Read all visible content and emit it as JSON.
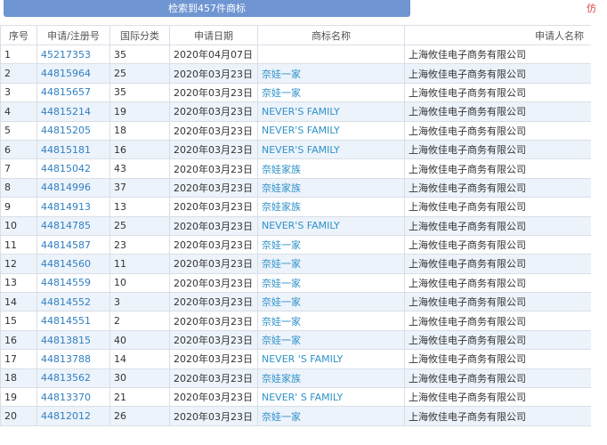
{
  "banner": {
    "text": "检索到457件商标"
  },
  "corner": {
    "text": "仿"
  },
  "table": {
    "headers": {
      "no": "序号",
      "regno": "申请/注册号",
      "cls": "国际分类",
      "date": "申请日期",
      "mark": "商标名称",
      "applicant": "申请人名称"
    },
    "rows": [
      {
        "no": "1",
        "regno": "45217353",
        "cls": "35",
        "date": "2020年04月07日",
        "mark": "",
        "applicant": "上海攸佳电子商务有限公司"
      },
      {
        "no": "2",
        "regno": "44815964",
        "cls": "25",
        "date": "2020年03月23日",
        "mark": "奈娃一家",
        "applicant": "上海攸佳电子商务有限公司"
      },
      {
        "no": "3",
        "regno": "44815657",
        "cls": "35",
        "date": "2020年03月23日",
        "mark": "奈娃一家",
        "applicant": "上海攸佳电子商务有限公司"
      },
      {
        "no": "4",
        "regno": "44815214",
        "cls": "19",
        "date": "2020年03月23日",
        "mark": "NEVER'S FAMILY",
        "applicant": "上海攸佳电子商务有限公司"
      },
      {
        "no": "5",
        "regno": "44815205",
        "cls": "18",
        "date": "2020年03月23日",
        "mark": "NEVER'S FAMILY",
        "applicant": "上海攸佳电子商务有限公司"
      },
      {
        "no": "6",
        "regno": "44815181",
        "cls": "16",
        "date": "2020年03月23日",
        "mark": "NEVER'S FAMILY",
        "applicant": "上海攸佳电子商务有限公司"
      },
      {
        "no": "7",
        "regno": "44815042",
        "cls": "43",
        "date": "2020年03月23日",
        "mark": "奈娃家族",
        "applicant": "上海攸佳电子商务有限公司"
      },
      {
        "no": "8",
        "regno": "44814996",
        "cls": "37",
        "date": "2020年03月23日",
        "mark": "奈娃家族",
        "applicant": "上海攸佳电子商务有限公司"
      },
      {
        "no": "9",
        "regno": "44814913",
        "cls": "13",
        "date": "2020年03月23日",
        "mark": "奈娃家族",
        "applicant": "上海攸佳电子商务有限公司"
      },
      {
        "no": "10",
        "regno": "44814785",
        "cls": "25",
        "date": "2020年03月23日",
        "mark": "NEVER'S FAMILY",
        "applicant": "上海攸佳电子商务有限公司"
      },
      {
        "no": "11",
        "regno": "44814587",
        "cls": "23",
        "date": "2020年03月23日",
        "mark": "奈娃一家",
        "applicant": "上海攸佳电子商务有限公司"
      },
      {
        "no": "12",
        "regno": "44814560",
        "cls": "11",
        "date": "2020年03月23日",
        "mark": "奈娃一家",
        "applicant": "上海攸佳电子商务有限公司"
      },
      {
        "no": "13",
        "regno": "44814559",
        "cls": "10",
        "date": "2020年03月23日",
        "mark": "奈娃一家",
        "applicant": "上海攸佳电子商务有限公司"
      },
      {
        "no": "14",
        "regno": "44814552",
        "cls": "3",
        "date": "2020年03月23日",
        "mark": "奈娃一家",
        "applicant": "上海攸佳电子商务有限公司"
      },
      {
        "no": "15",
        "regno": "44814551",
        "cls": "2",
        "date": "2020年03月23日",
        "mark": "奈娃一家",
        "applicant": "上海攸佳电子商务有限公司"
      },
      {
        "no": "16",
        "regno": "44813815",
        "cls": "40",
        "date": "2020年03月23日",
        "mark": "奈娃一家",
        "applicant": "上海攸佳电子商务有限公司"
      },
      {
        "no": "17",
        "regno": "44813788",
        "cls": "14",
        "date": "2020年03月23日",
        "mark": "NEVER 'S FAMILY",
        "applicant": "上海攸佳电子商务有限公司"
      },
      {
        "no": "18",
        "regno": "44813562",
        "cls": "30",
        "date": "2020年03月23日",
        "mark": "奈娃家族",
        "applicant": "上海攸佳电子商务有限公司"
      },
      {
        "no": "19",
        "regno": "44813370",
        "cls": "21",
        "date": "2020年03月23日",
        "mark": "NEVER' S FAMILY",
        "applicant": "上海攸佳电子商务有限公司"
      },
      {
        "no": "20",
        "regno": "44812012",
        "cls": "26",
        "date": "2020年03月23日",
        "mark": "奈娃一家",
        "applicant": "上海攸佳电子商务有限公司"
      }
    ]
  }
}
